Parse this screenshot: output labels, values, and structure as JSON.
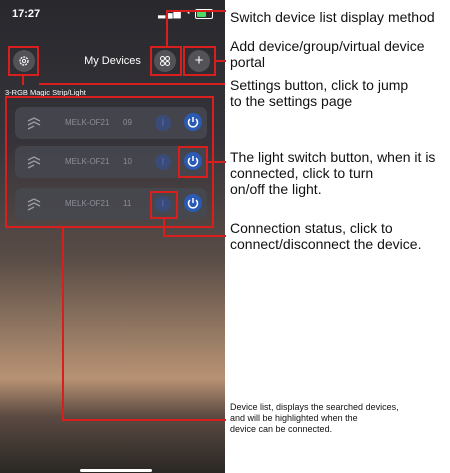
{
  "status": {
    "time": "17:27",
    "signal": "▂▄▆",
    "wifi": "◔"
  },
  "header": {
    "title": "My Devices",
    "settings_icon": "gear-icon",
    "grid_icon": "grid-icon",
    "add_icon": "plus-icon"
  },
  "group": {
    "title": "3-RGB Magic Strip/Light"
  },
  "devices": [
    {
      "name": "MELK-OF21",
      "number": "09"
    },
    {
      "name": "MELK-OF21",
      "number": "10"
    },
    {
      "name": "MELK-OF21",
      "number": "11"
    }
  ],
  "annotations": {
    "switch_display": "Switch device list display method",
    "add_device": "Add device/group/virtual device\nportal",
    "settings": "Settings button, click to jump\nto the settings page",
    "light_switch": "The light switch button, when it is\nconnected, click to turn\non/off the light.",
    "connection": "Connection status, click to\nconnect/disconnect the device.",
    "device_list": "Device list, displays the searched devices,\nand will be highlighted when the\ndevice can be connected."
  },
  "colors": {
    "highlight": "#d91e1e",
    "power": "#2a5ab3"
  }
}
